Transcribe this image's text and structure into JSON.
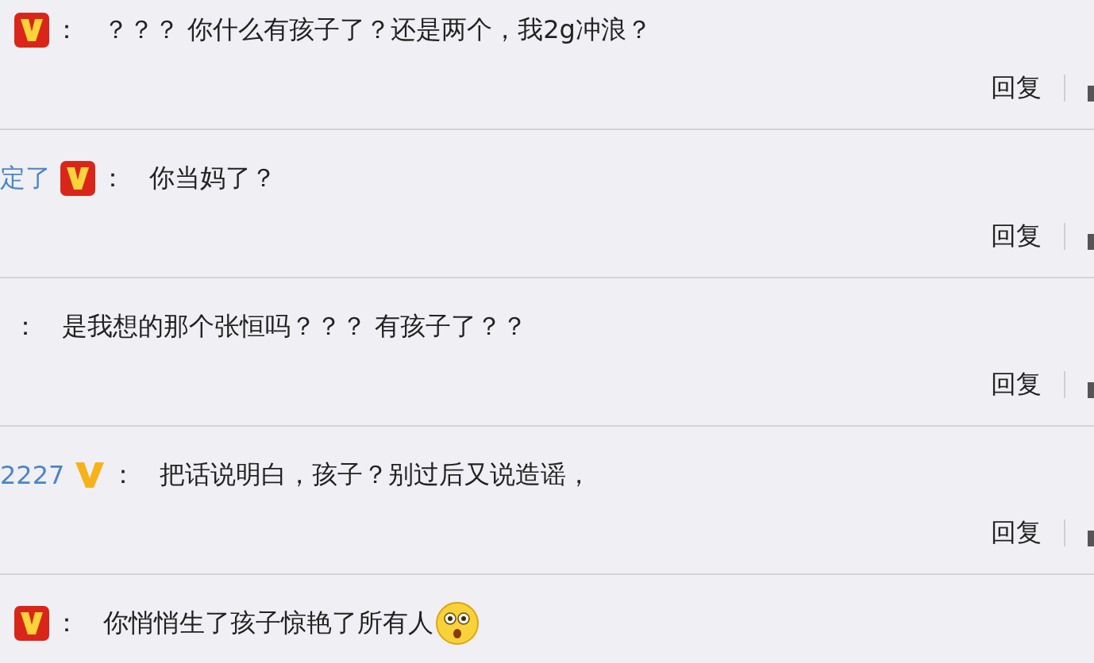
{
  "comments": [
    {
      "badge": {
        "kind": "vip"
      },
      "separator": "：",
      "text": "？？？ 你什么有孩子了？还是两个，我2g冲浪？",
      "reply": "回复"
    },
    {
      "username": "定了",
      "badge": {
        "kind": "vip"
      },
      "separator": "：",
      "text": "你当妈了？",
      "reply": "回复"
    },
    {
      "separator": "：",
      "text": "是我想的那个张恒吗？？？ 有孩子了？？",
      "reply": "回复"
    },
    {
      "username": "2227",
      "badge": {
        "kind": "verified"
      },
      "separator": "：",
      "text": "把话说明白，孩子？别过后又说造谣，",
      "reply": "回复"
    },
    {
      "badge": {
        "kind": "vip"
      },
      "separator": "：",
      "text": "你悄悄生了孩子惊艳了所有人",
      "emoji": {
        "kind": "surprised"
      }
    }
  ]
}
